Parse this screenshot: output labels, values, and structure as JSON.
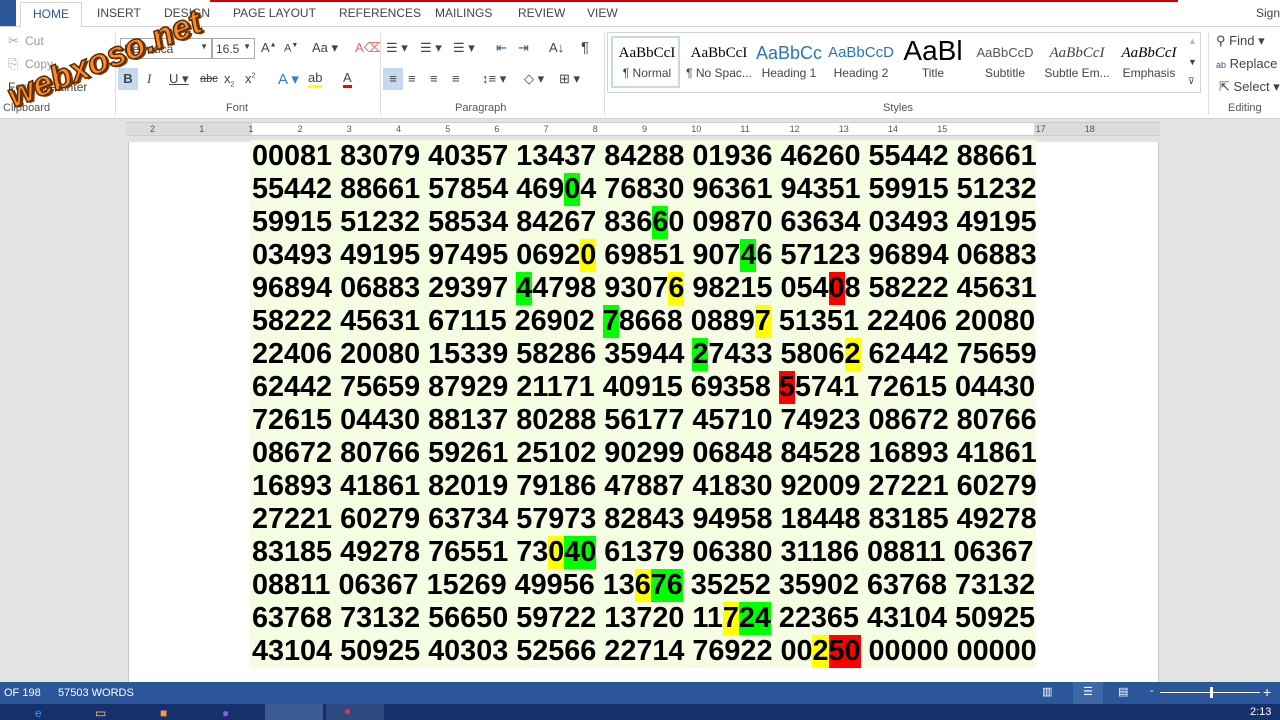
{
  "tabs": [
    "HOME",
    "INSERT",
    "DESIGN",
    "PAGE LAYOUT",
    "REFERENCES",
    "MAILINGS",
    "REVIEW",
    "VIEW"
  ],
  "sign_in": "Sign",
  "clipboard": {
    "cut": "Cut",
    "copy": "Copy",
    "format_painter": "Format Painter",
    "label": "Clipboard"
  },
  "font": {
    "name": "Helvetica",
    "size": "16.5",
    "label": "Font",
    "colors": {
      "highlight": "#ffff00",
      "font_color": "#ff0000"
    }
  },
  "paragraph": {
    "label": "Paragraph"
  },
  "styles": {
    "label": "Styles",
    "items": [
      {
        "preview": "AaBbCcI",
        "name": "¶ Normal"
      },
      {
        "preview": "AaBbCcI",
        "name": "¶ No Spac..."
      },
      {
        "preview": "AaBbCc",
        "name": "Heading 1"
      },
      {
        "preview": "AaBbCcD",
        "name": "Heading 2"
      },
      {
        "preview": "AaBl",
        "name": "Title"
      },
      {
        "preview": "AaBbCcD",
        "name": "Subtitle"
      },
      {
        "preview": "AaBbCcI",
        "name": "Subtle Em..."
      },
      {
        "preview": "AaBbCcI",
        "name": "Emphasis"
      }
    ]
  },
  "editing": {
    "find": "Find",
    "replace": "Replace",
    "select": "Select",
    "label": "Editing"
  },
  "ruler_numbers": [
    "2",
    "1",
    "1",
    "2",
    "3",
    "4",
    "5",
    "6",
    "7",
    "8",
    "9",
    "10",
    "11",
    "12",
    "13",
    "14",
    "15",
    "",
    "17",
    "18"
  ],
  "watermark": "webxoso.net",
  "rows": [
    "00081 83079 40357 13437 84288 01936 46260 55442 88661",
    "55442 88661 57854 46904 76830 96361 94351 59915 51232",
    "59915 51232 58534 84267 83660 09870 63634 03493 49195",
    "03493 49195 97495 06920 69851 90746 57123 96894 06883",
    "96894 06883 29397 44798 93076 98215 05408 58222 45631",
    "58222 45631 67115 26902 78668 08897 51351 22406 20080",
    "22406 20080 15339 58286 35944 27433 58062 62442 75659",
    "62442 75659 87929 21171 40915 69358 55741 72615 04430",
    "72615 04430 88137 80288 56177 45710 74923 08672 80766",
    "08672 80766 59261 25102 90299 06848 84528 16893 41861",
    "16893 41861 82019 79186 47887 41830 92009 27221 60279",
    "27221 60279 63734 57973 82843 94958 18448 83185 49278",
    "83185 49278 76551 73040 61379 06380 31186 08811 06367",
    "08811 06367 15269 49956 13676 35252 35902 63768 73132",
    "63768 73132 56650 59722 13720 11724 22365 43104 50925",
    "43104 50925 40303 52566 22714 76922 00250 00000 00000"
  ],
  "highlights": [
    {
      "row": 1,
      "group": 3,
      "digit": 3,
      "len": 1,
      "color": "green"
    },
    {
      "row": 2,
      "group": 4,
      "digit": 3,
      "len": 1,
      "color": "green"
    },
    {
      "row": 3,
      "group": 3,
      "digit": 4,
      "len": 1,
      "color": "yellow"
    },
    {
      "row": 3,
      "group": 5,
      "digit": 3,
      "len": 1,
      "color": "green"
    },
    {
      "row": 4,
      "group": 3,
      "digit": 0,
      "len": 1,
      "color": "green"
    },
    {
      "row": 4,
      "group": 4,
      "digit": 4,
      "len": 1,
      "color": "yellow"
    },
    {
      "row": 4,
      "group": 6,
      "digit": 3,
      "len": 1,
      "color": "red"
    },
    {
      "row": 5,
      "group": 4,
      "digit": 0,
      "len": 1,
      "color": "green"
    },
    {
      "row": 5,
      "group": 5,
      "digit": 4,
      "len": 1,
      "color": "yellow"
    },
    {
      "row": 6,
      "group": 5,
      "digit": 0,
      "len": 1,
      "color": "green"
    },
    {
      "row": 6,
      "group": 6,
      "digit": 4,
      "len": 1,
      "color": "yellow"
    },
    {
      "row": 7,
      "group": 6,
      "digit": 0,
      "len": 1,
      "color": "red"
    },
    {
      "row": 12,
      "group": 3,
      "digit": 2,
      "len": 1,
      "color": "yellow"
    },
    {
      "row": 12,
      "group": 3,
      "digit": 3,
      "len": 2,
      "color": "green"
    },
    {
      "row": 13,
      "group": 4,
      "digit": 2,
      "len": 1,
      "color": "yellow"
    },
    {
      "row": 13,
      "group": 4,
      "digit": 3,
      "len": 2,
      "color": "green"
    },
    {
      "row": 14,
      "group": 5,
      "digit": 2,
      "len": 1,
      "color": "yellow"
    },
    {
      "row": 14,
      "group": 5,
      "digit": 3,
      "len": 2,
      "color": "green"
    },
    {
      "row": 15,
      "group": 6,
      "digit": 2,
      "len": 1,
      "color": "yellow"
    },
    {
      "row": 15,
      "group": 6,
      "digit": 3,
      "len": 2,
      "color": "red"
    }
  ],
  "status": {
    "page": "OF 198",
    "words": "57503 WORDS",
    "zoom_level_percent": 100
  },
  "taskbar": {
    "clock": "2:13"
  }
}
